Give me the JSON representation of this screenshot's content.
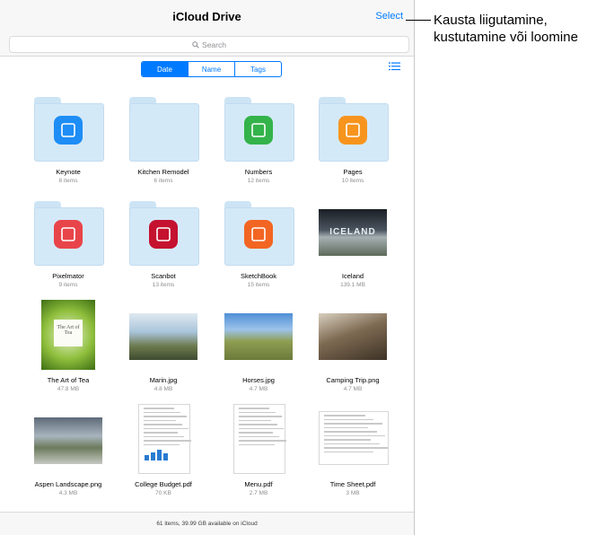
{
  "header": {
    "title": "iCloud Drive",
    "select_label": "Select"
  },
  "search": {
    "placeholder": "Search"
  },
  "sort": {
    "options": [
      "Date",
      "Name",
      "Tags"
    ],
    "active": "Date"
  },
  "items": [
    {
      "name": "Keynote",
      "sub": "8 items",
      "kind": "folder",
      "icon": "keynote-icon",
      "color": "#1e8df5"
    },
    {
      "name": "Kitchen Remodel",
      "sub": "6 items",
      "kind": "folder"
    },
    {
      "name": "Numbers",
      "sub": "12 items",
      "kind": "folder",
      "icon": "numbers-icon",
      "color": "#34b34a"
    },
    {
      "name": "Pages",
      "sub": "10 items",
      "kind": "folder",
      "icon": "pages-icon",
      "color": "#f7941d"
    },
    {
      "name": "Pixelmator",
      "sub": "9 items",
      "kind": "folder",
      "icon": "pixelmator-icon",
      "color": "#e8454a"
    },
    {
      "name": "Scanbot",
      "sub": "13 items",
      "kind": "folder",
      "icon": "scanbot-icon",
      "color": "#c4122f"
    },
    {
      "name": "SketchBook",
      "sub": "15 items",
      "kind": "folder",
      "icon": "sketchbook-icon",
      "color": "#f26522"
    },
    {
      "name": "Iceland",
      "sub": "139.1 MB",
      "kind": "photo",
      "photo_text": "ICELAND"
    },
    {
      "name": "The Art of Tea",
      "sub": "47.8 MB",
      "kind": "book",
      "book_title": "The Art of Tea"
    },
    {
      "name": "Marin.jpg",
      "sub": "4.8 MB",
      "kind": "photo"
    },
    {
      "name": "Horses.jpg",
      "sub": "4.7 MB",
      "kind": "photo"
    },
    {
      "name": "Camping Trip.png",
      "sub": "4.7 MB",
      "kind": "photo"
    },
    {
      "name": "Aspen Landscape.png",
      "sub": "4.3 MB",
      "kind": "photo"
    },
    {
      "name": "College Budget.pdf",
      "sub": "70 KB",
      "kind": "doc"
    },
    {
      "name": "Menu.pdf",
      "sub": "2.7 MB",
      "kind": "doc"
    },
    {
      "name": "Time Sheet.pdf",
      "sub": "3 MB",
      "kind": "doc"
    }
  ],
  "footer": {
    "status": "61 items, 39.99 GB available on iCloud"
  },
  "callout": {
    "line1": "Kausta liigutamine,",
    "line2": "kustutamine või loomine"
  }
}
